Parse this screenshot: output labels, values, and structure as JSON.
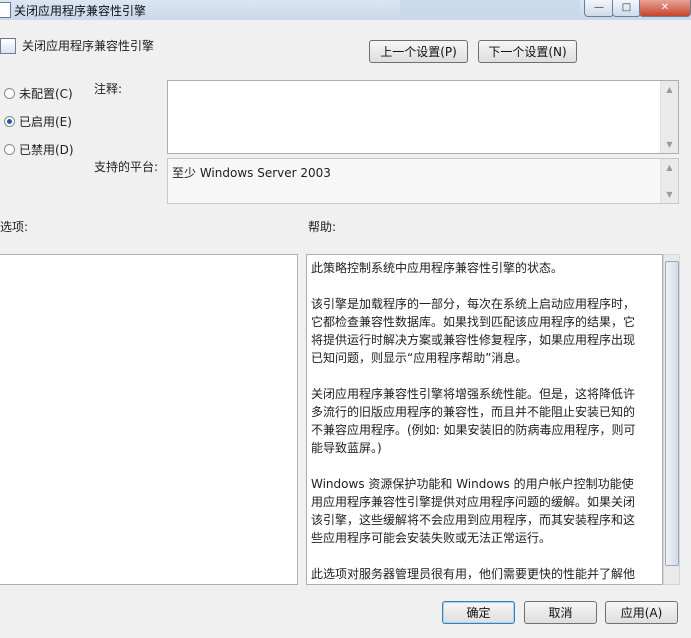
{
  "window": {
    "title": "关闭应用程序兼容性引擎",
    "min_label": "—",
    "max_label": "□",
    "close_label": "✕"
  },
  "header": {
    "title": "关闭应用程序兼容性引擎",
    "prev_label": "上一个设置(P)",
    "next_label": "下一个设置(N)"
  },
  "state": {
    "options": [
      {
        "label": "未配置(C)",
        "selected": false
      },
      {
        "label": "已启用(E)",
        "selected": true
      },
      {
        "label": "已禁用(D)",
        "selected": false
      }
    ]
  },
  "comment": {
    "label": "注释:",
    "value": ""
  },
  "platform": {
    "label": "支持的平台:",
    "value": "至少 Windows Server 2003"
  },
  "options_section": {
    "label": "选项:"
  },
  "help_section": {
    "label": "帮助:",
    "paragraphs": [
      " 此策略控制系统中应用程序兼容性引擎的状态。",
      "该引擎是加载程序的一部分，每次在系统上启动应用程序时，它都检查兼容性数据库。如果找到匹配该应用程序的结果，它将提供运行时解决方案或兼容性修复程序，如果应用程序出现已知问题，则显示“应用程序帮助”消息。",
      "关闭应用程序兼容性引擎将增强系统性能。但是，这将降低许多流行的旧版应用程序的兼容性，而且并不能阻止安装已知的不兼容应用程序。(例如: 如果安装旧的防病毒应用程序，则可能导致蓝屏。)",
      "Windows 资源保护功能和 Windows 的用户帐户控制功能使用应用程序兼容性引擎提供对应用程序问题的缓解。如果关闭该引擎，这些缓解将不会应用到应用程序，而其安装程序和这些应用程序可能会安装失败或无法正常运行。",
      "此选项对服务器管理员很有用，他们需要更快的性能并了解他们所用应用程序的兼容性。对于每秒钟可能启动数百次应用程序且加载"
    ]
  },
  "footer": {
    "ok_label": "确定",
    "cancel_label": "取消",
    "apply_label": "应用(A)"
  }
}
